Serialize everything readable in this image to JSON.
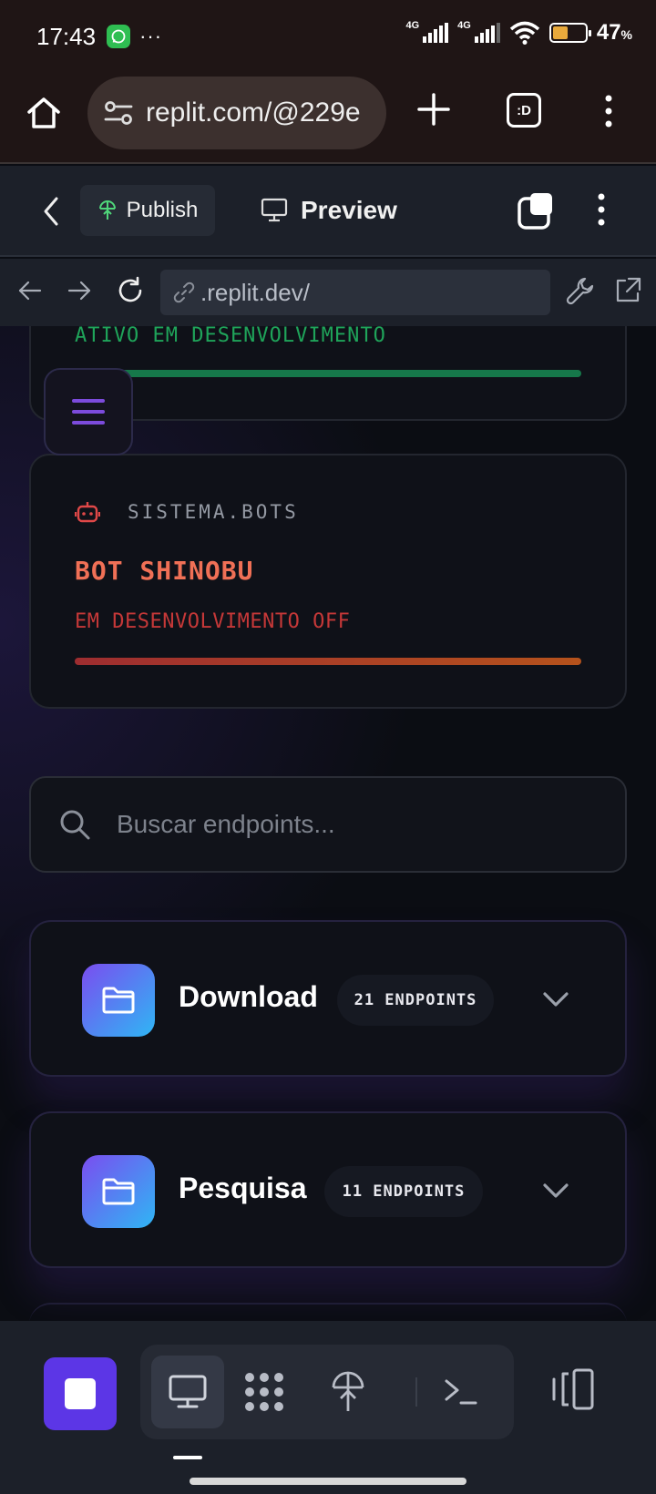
{
  "status_bar": {
    "time": "17:43",
    "more_dots": "···",
    "signal_1_label": "4G",
    "signal_2_label": "4G",
    "battery_percent": "47",
    "battery_unit": "%",
    "battery_level": 0.47
  },
  "browser": {
    "url": "replit.com/@229e",
    "tabs_label": ":D"
  },
  "replit_header": {
    "publish_label": "Publish",
    "preview_label": "Preview"
  },
  "devtools": {
    "url": ".replit.dev/"
  },
  "top_card": {
    "status": "ATIVO EM DESENVOLVIMENTO"
  },
  "bot_card": {
    "system_label": "SISTEMA.BOTS",
    "name": "BOT SHINOBU",
    "status": "EM DESENVOLVIMENTO OFF"
  },
  "search": {
    "placeholder": "Buscar endpoints..."
  },
  "categories": [
    {
      "title": "Download",
      "badge": "21 ENDPOINTS"
    },
    {
      "title": "Pesquisa",
      "badge": "11 ENDPOINTS"
    }
  ],
  "colors": {
    "accent_purple": "#5c36e6",
    "status_green": "#1fa45a",
    "bot_name": "#f07056",
    "status_red": "#c53838"
  }
}
